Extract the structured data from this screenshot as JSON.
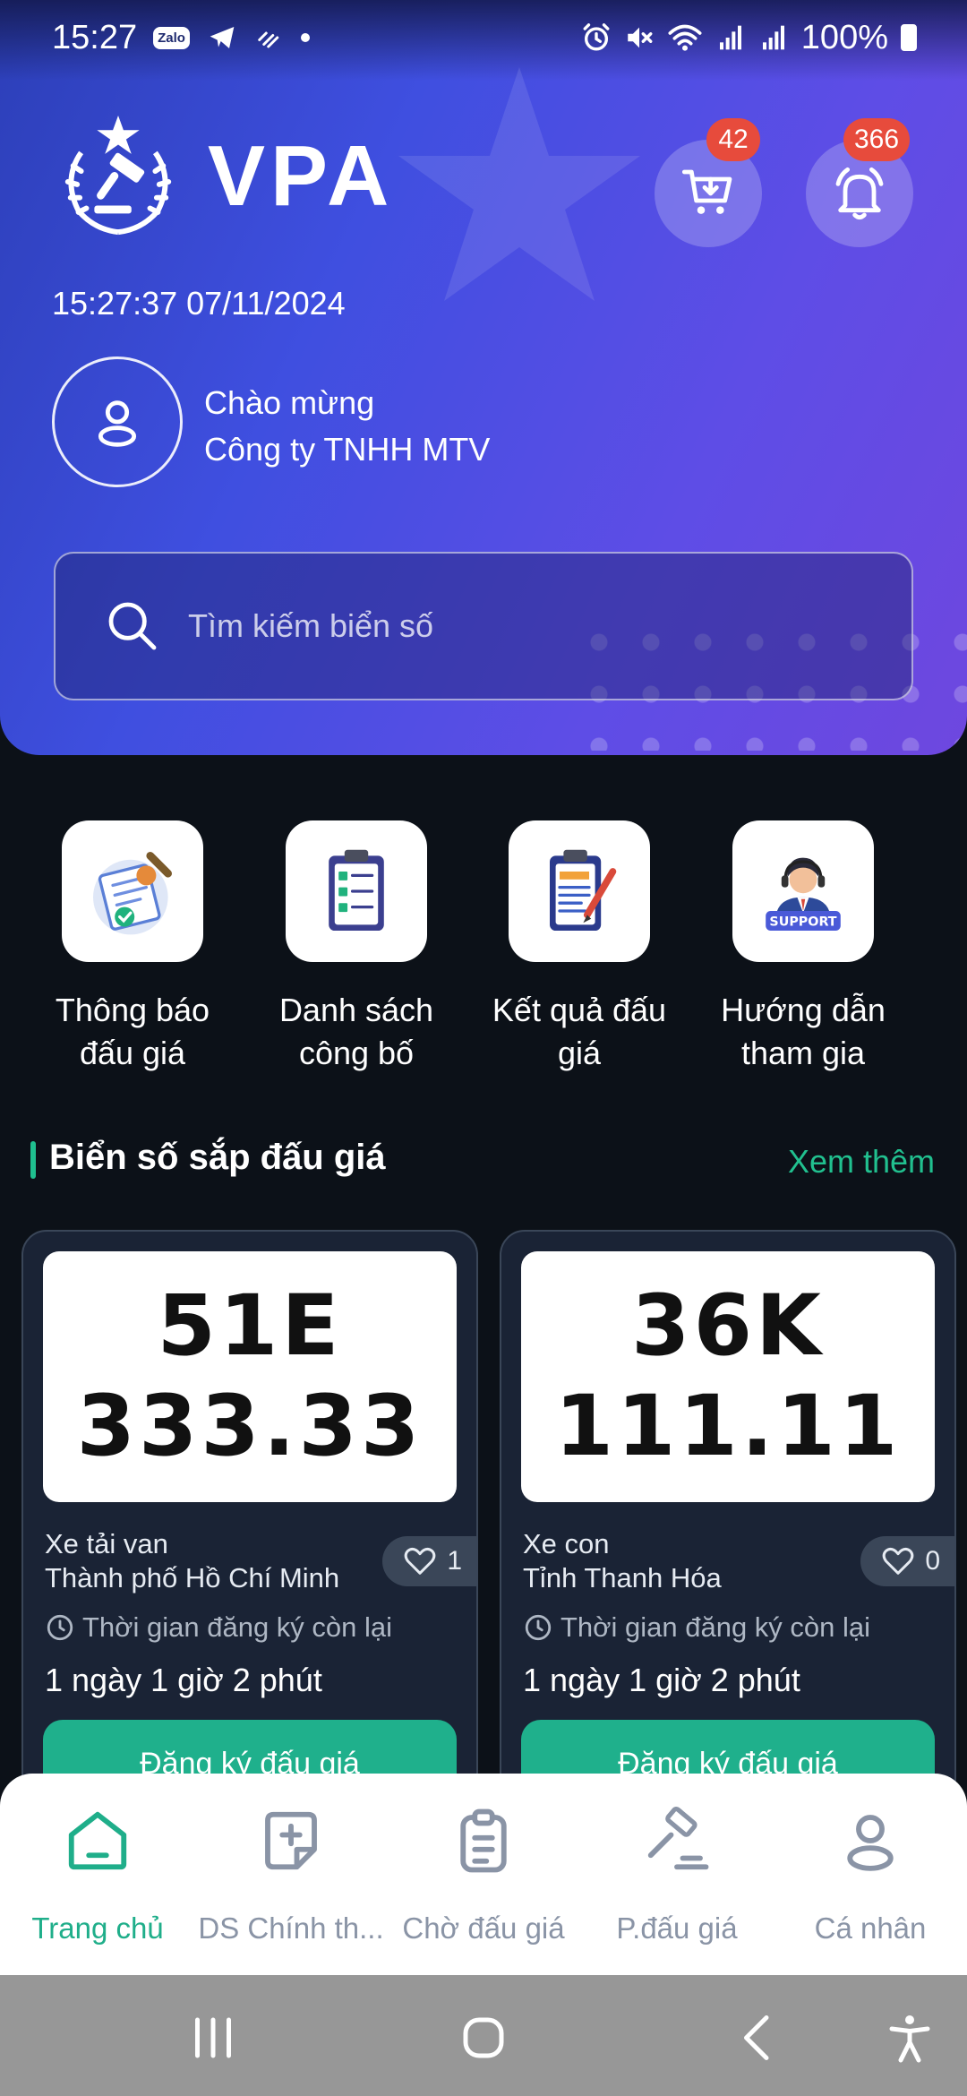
{
  "status_bar": {
    "time": "15:27",
    "battery": "100%",
    "zalo_label": "Zalo"
  },
  "header": {
    "app_name": "VPA",
    "cart_badge": "42",
    "notification_badge": "366",
    "datetime": "15:27:37 07/11/2024",
    "greeting": "Chào mừng",
    "company": "Công ty TNHH MTV",
    "search_placeholder": "Tìm kiếm biển số"
  },
  "quick_actions": [
    {
      "line1": "Thông báo",
      "line2": "đấu giá",
      "icon": "announcement-icon"
    },
    {
      "line1": "Danh sách",
      "line2": "công bố",
      "icon": "checklist-icon"
    },
    {
      "line1": "Kết quả đấu",
      "line2": "giá",
      "icon": "results-clipboard-icon"
    },
    {
      "line1": "Hướng dẫn",
      "line2": "tham gia",
      "icon": "support-icon",
      "badge_text": "SUPPORT"
    }
  ],
  "section": {
    "title": "Biển số sắp đấu giá",
    "see_more": "Xem thêm"
  },
  "plates": [
    {
      "line1": "51E",
      "line2": "333.33",
      "vehicle_type": "Xe tải van",
      "location": "Thành phố Hồ Chí Minh",
      "likes": "1",
      "remaining_label": "Thời gian đăng ký còn lại",
      "countdown": "1 ngày 1 giờ 2 phút",
      "register_label": "Đăng ký đấu giá"
    },
    {
      "line1": "36K",
      "line2": "111.11",
      "vehicle_type": "Xe con",
      "location": "Tỉnh Thanh Hóa",
      "likes": "0",
      "remaining_label": "Thời gian đăng ký còn lại",
      "countdown": "1 ngày 1 giờ 2 phút",
      "register_label": "Đăng ký đấu giá"
    }
  ],
  "bottom_nav": [
    {
      "label": "Trang chủ",
      "icon": "home-icon",
      "active": true
    },
    {
      "label": "DS Chính th...",
      "icon": "add-document-icon",
      "active": false
    },
    {
      "label": "Chờ đấu giá",
      "icon": "clipboard-list-icon",
      "active": false
    },
    {
      "label": "P.đấu giá",
      "icon": "gavel-icon",
      "active": false
    },
    {
      "label": "Cá nhân",
      "icon": "user-icon",
      "active": false
    }
  ],
  "colors": {
    "accent_green": "#1fae8a",
    "badge_red": "#e74b3c",
    "header_gradient_start": "#2c3fb8",
    "header_gradient_end": "#6e47df",
    "background_dark": "#0c1118"
  }
}
